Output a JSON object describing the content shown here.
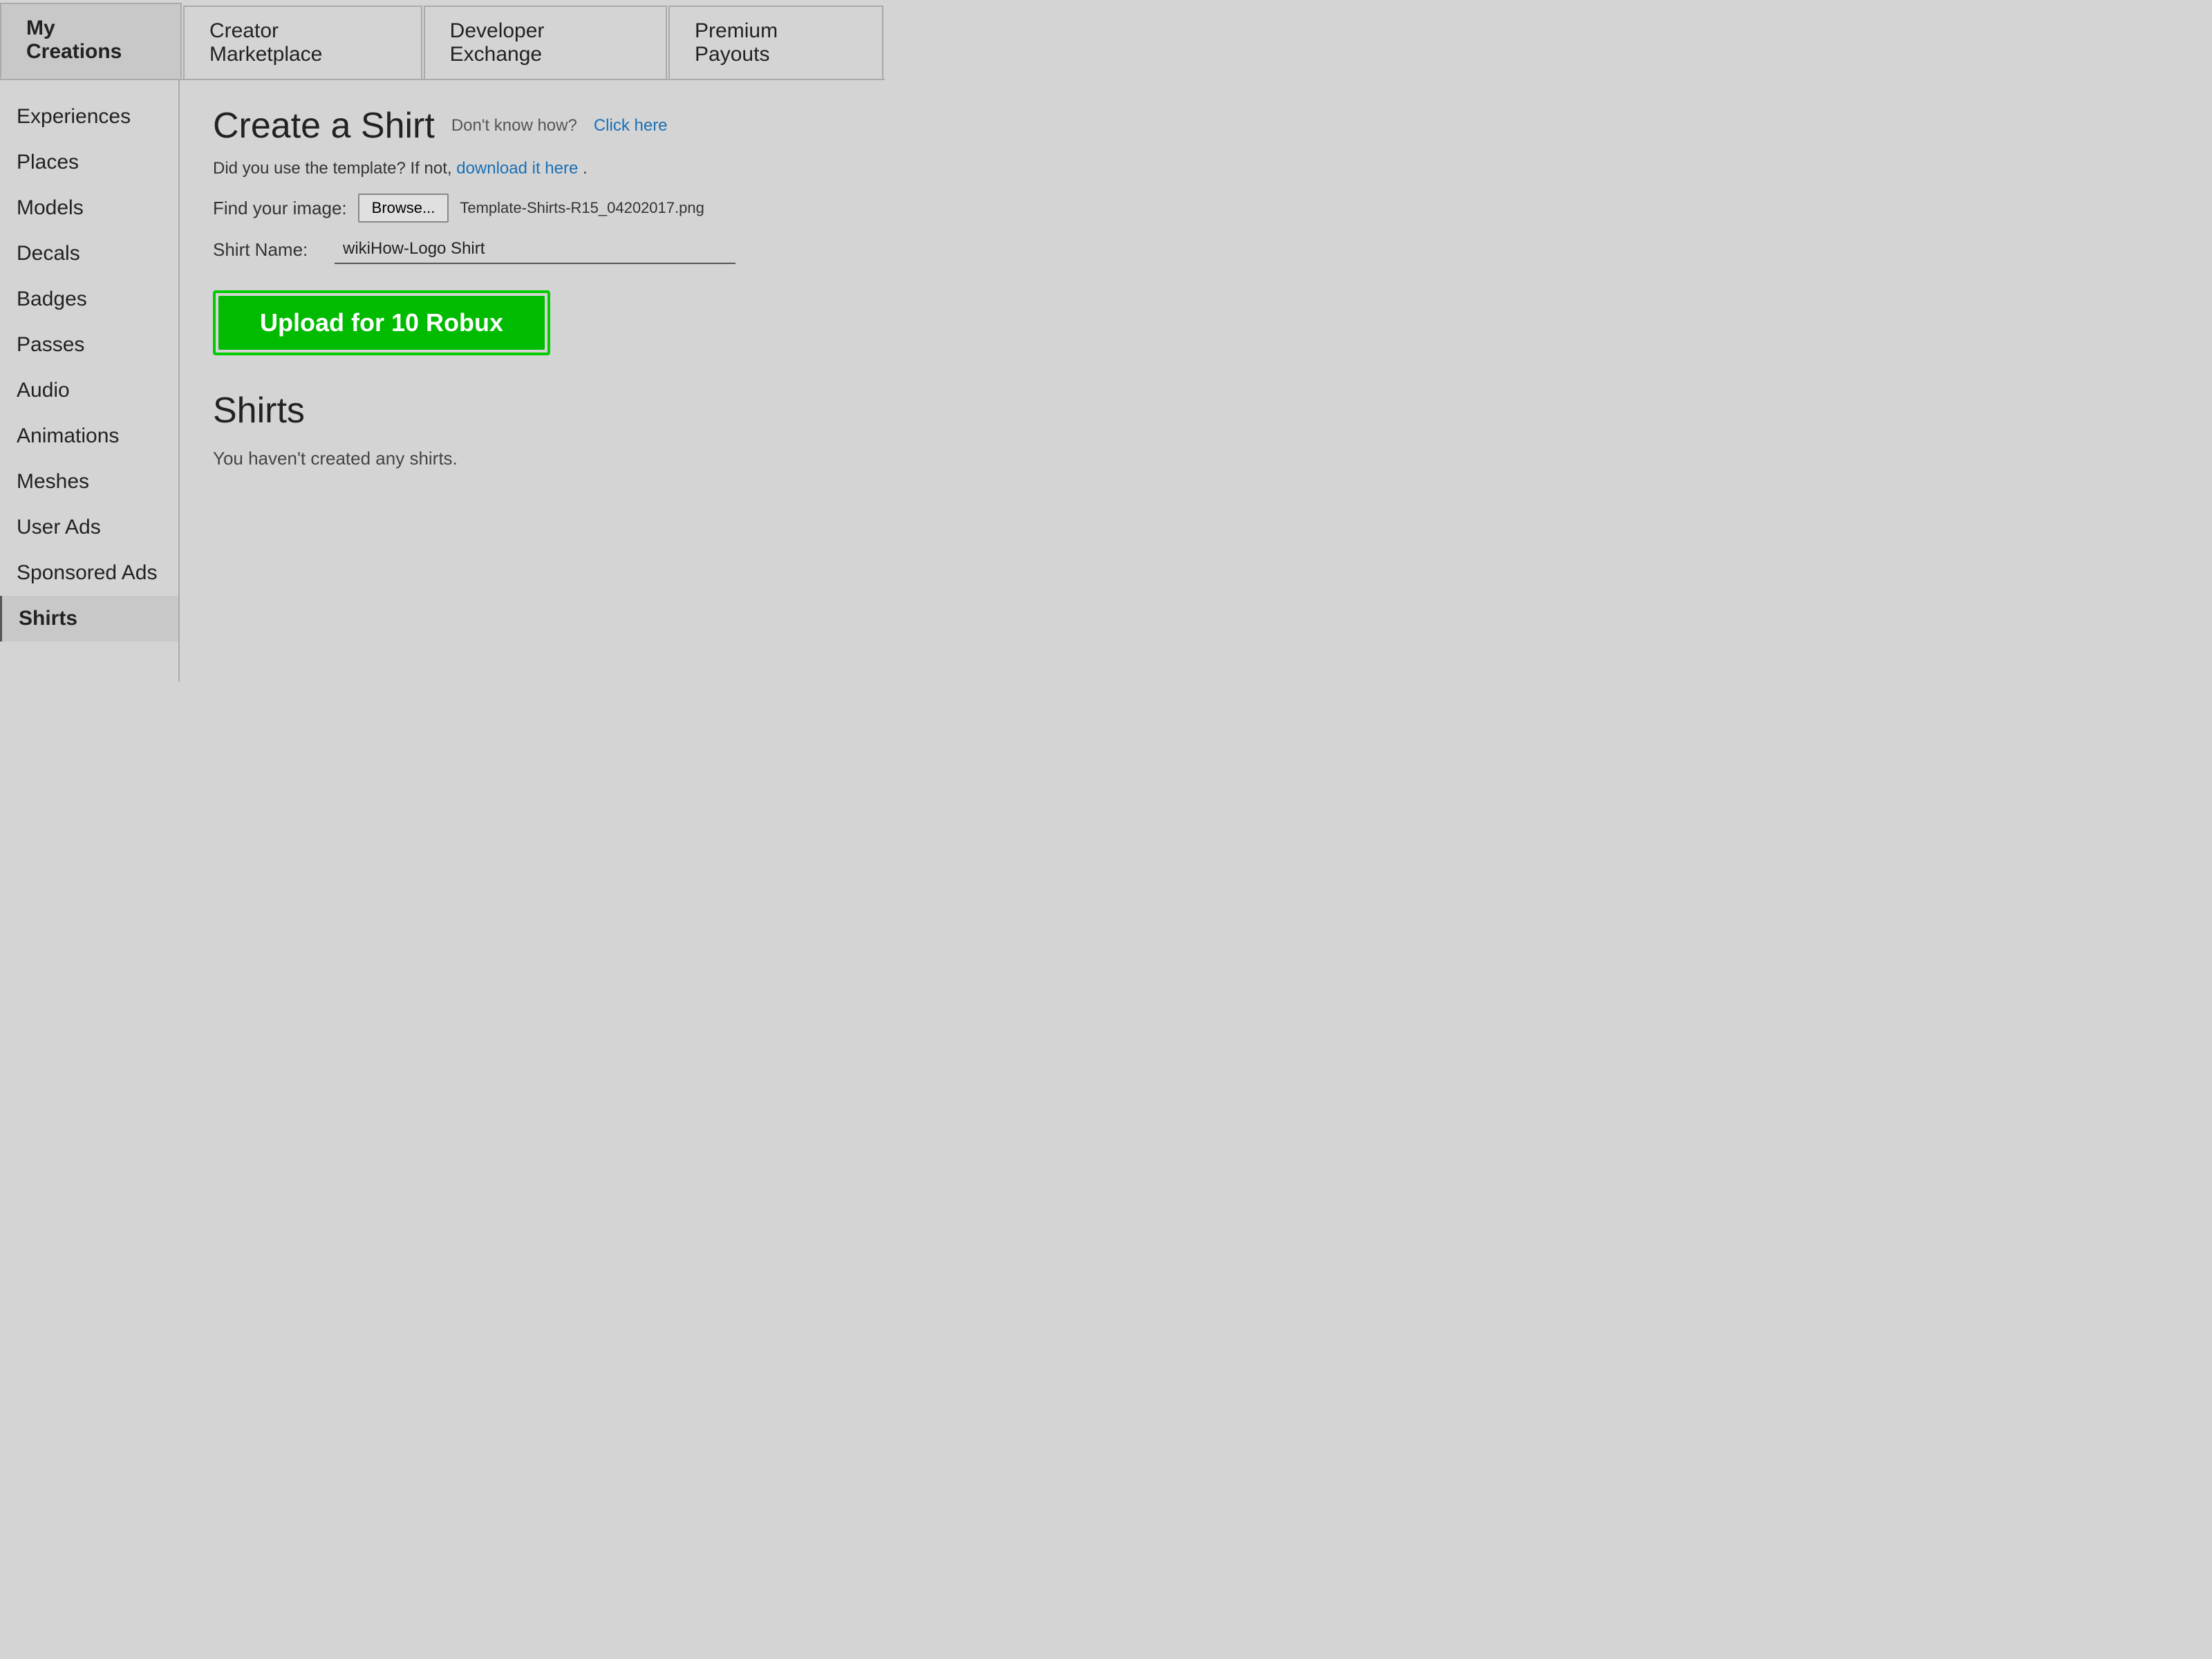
{
  "tabs": [
    {
      "id": "my-creations",
      "label": "My Creations",
      "active": true
    },
    {
      "id": "creator-marketplace",
      "label": "Creator Marketplace",
      "active": false
    },
    {
      "id": "developer-exchange",
      "label": "Developer Exchange",
      "active": false
    },
    {
      "id": "premium-payouts",
      "label": "Premium Payouts",
      "active": false
    }
  ],
  "sidebar": {
    "items": [
      {
        "id": "experiences",
        "label": "Experiences",
        "active": false
      },
      {
        "id": "places",
        "label": "Places",
        "active": false
      },
      {
        "id": "models",
        "label": "Models",
        "active": false
      },
      {
        "id": "decals",
        "label": "Decals",
        "active": false
      },
      {
        "id": "badges",
        "label": "Badges",
        "active": false
      },
      {
        "id": "passes",
        "label": "Passes",
        "active": false
      },
      {
        "id": "audio",
        "label": "Audio",
        "active": false
      },
      {
        "id": "animations",
        "label": "Animations",
        "active": false
      },
      {
        "id": "meshes",
        "label": "Meshes",
        "active": false
      },
      {
        "id": "user-ads",
        "label": "User Ads",
        "active": false
      },
      {
        "id": "sponsored-ads",
        "label": "Sponsored Ads",
        "active": false
      },
      {
        "id": "shirts",
        "label": "Shirts",
        "active": true
      }
    ]
  },
  "content": {
    "create_title": "Create a Shirt",
    "dont_know_text": "Don't know how?",
    "click_here_text": "Click here",
    "template_text": "Did you use the template? If not,",
    "download_link_text": "download it here",
    "template_period": ".",
    "find_image_label": "Find your image:",
    "browse_button_label": "Browse...",
    "file_name": "Template-Shirts-R15_04202017.png",
    "shirt_name_label": "Shirt Name:",
    "shirt_name_value": "wikiHow-Logo Shirt",
    "upload_button_label": "Upload for 10 Robux",
    "shirts_section_title": "Shirts",
    "no_shirts_text": "You haven't created any shirts."
  }
}
